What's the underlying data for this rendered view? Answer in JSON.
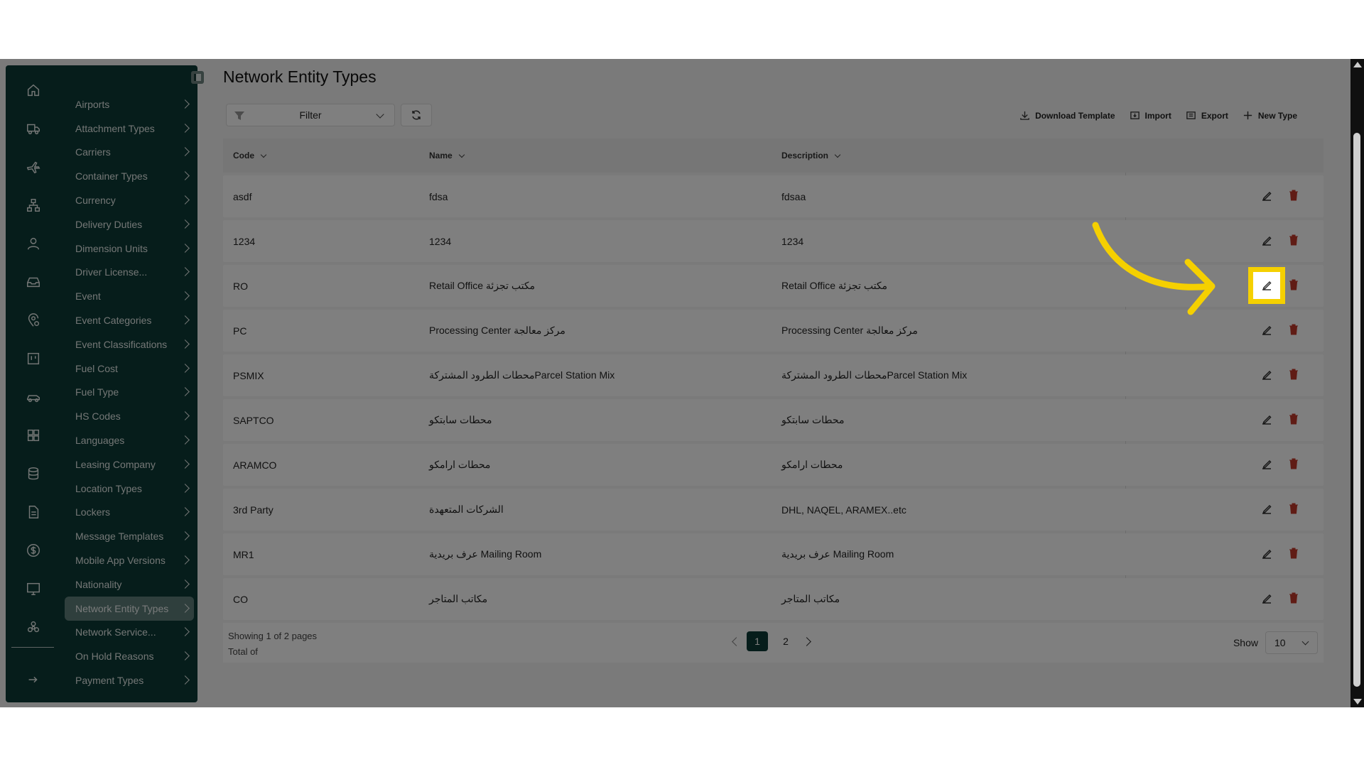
{
  "sidebar": {
    "menu": [
      {
        "label": "Airports"
      },
      {
        "label": "Attachment Types"
      },
      {
        "label": "Carriers"
      },
      {
        "label": "Container Types"
      },
      {
        "label": "Currency"
      },
      {
        "label": "Delivery Duties"
      },
      {
        "label": "Dimension Units"
      },
      {
        "label": "Driver License..."
      },
      {
        "label": "Event"
      },
      {
        "label": "Event Categories"
      },
      {
        "label": "Event Classifications"
      },
      {
        "label": "Fuel Cost"
      },
      {
        "label": "Fuel Type"
      },
      {
        "label": "HS Codes"
      },
      {
        "label": "Languages"
      },
      {
        "label": "Leasing Company"
      },
      {
        "label": "Location Types"
      },
      {
        "label": "Lockers"
      },
      {
        "label": "Message Templates"
      },
      {
        "label": "Mobile App Versions"
      },
      {
        "label": "Nationality"
      },
      {
        "label": "Network Entity Types"
      },
      {
        "label": "Network Service..."
      },
      {
        "label": "On Hold Reasons"
      },
      {
        "label": "Payment Types"
      }
    ],
    "active_item": "Network Entity Types",
    "rail_icons": [
      "home-icon",
      "truck-icon",
      "plane-icon",
      "org-chart-icon",
      "user-icon",
      "inbox-icon",
      "location-settings-icon",
      "kanban-icon",
      "car-icon",
      "dashboard-grid-icon",
      "database-icon",
      "document-icon",
      "dollar-icon",
      "monitor-icon",
      "network-icon",
      "logout-icon"
    ]
  },
  "page": {
    "title": "Network Entity Types"
  },
  "toolbar": {
    "filter_label": "Filter",
    "download_template": "Download Template",
    "import": "Import",
    "export": "Export",
    "new_type": "New Type"
  },
  "table": {
    "columns": [
      "Code",
      "Name",
      "Description"
    ],
    "rows": [
      {
        "code": "asdf",
        "name": "fdsa",
        "description": "fdsaa"
      },
      {
        "code": "1234",
        "name": "1234",
        "description": "1234"
      },
      {
        "code": "RO",
        "name": "Retail Office مكتب تجزئة",
        "description": "Retail Office مكتب تجزئة"
      },
      {
        "code": "PC",
        "name": "Processing Center مركز معالجة",
        "description": "Processing Center مركز معالجة"
      },
      {
        "code": "PSMIX",
        "name": "محطات الطرود المشتركةParcel Station Mix",
        "description": "محطات الطرود المشتركةParcel Station Mix"
      },
      {
        "code": "SAPTCO",
        "name": "محطات سابتكو",
        "description": "محطات سابتكو"
      },
      {
        "code": "ARAMCO",
        "name": "محطات ارامكو",
        "description": "محطات ارامكو"
      },
      {
        "code": "3rd Party",
        "name": "الشركات المتعهدة",
        "description": "DHL, NAQEL, ARAMEX..etc"
      },
      {
        "code": "MR1",
        "name": "عرف بريدية Mailing Room",
        "description": "عرف بريدية Mailing Room"
      },
      {
        "code": "CO",
        "name": "مكاتب المتاجر",
        "description": "مكاتب المتاجر"
      }
    ]
  },
  "footer": {
    "showing": "Showing 1 of 2 pages",
    "total": "Total of",
    "pages": [
      "1",
      "2"
    ],
    "current_page": "1",
    "show_label": "Show",
    "page_size": "10"
  },
  "colors": {
    "sidebar_bg": "#0d3b36",
    "active_item": "#5e7f7b",
    "highlight": "#f5d000",
    "delete_red": "#c0392b"
  }
}
